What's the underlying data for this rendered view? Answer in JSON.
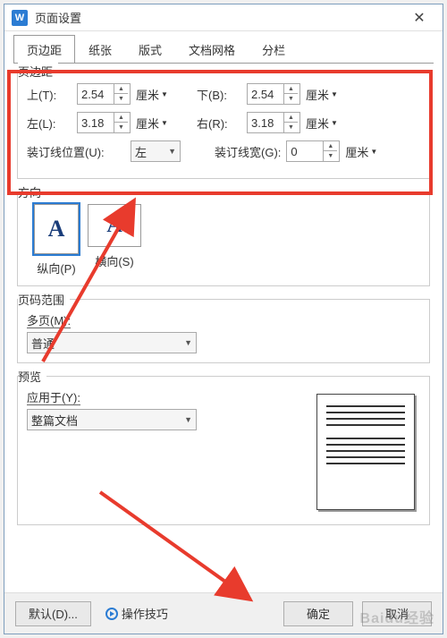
{
  "title": "页面设置",
  "tabs": [
    "页边距",
    "纸张",
    "版式",
    "文档网格",
    "分栏"
  ],
  "margins": {
    "legend": "页边距",
    "top": {
      "label": "上(T):",
      "value": "2.54",
      "unit": "厘米"
    },
    "bottom": {
      "label": "下(B):",
      "value": "2.54",
      "unit": "厘米"
    },
    "left": {
      "label": "左(L):",
      "value": "3.18",
      "unit": "厘米"
    },
    "right": {
      "label": "右(R):",
      "value": "3.18",
      "unit": "厘米"
    },
    "gutter_pos": {
      "label": "装订线位置(U):",
      "value": "左"
    },
    "gutter_w": {
      "label": "装订线宽(G):",
      "value": "0",
      "unit": "厘米"
    }
  },
  "orientation": {
    "legend": "方向",
    "portrait": "纵向(P)",
    "landscape": "横向(S)"
  },
  "page_range": {
    "legend": "页码范围",
    "multi_label": "多页(M):",
    "multi_value": "普通"
  },
  "preview": {
    "legend": "预览",
    "apply_label": "应用于(Y):",
    "apply_value": "整篇文档"
  },
  "footer": {
    "default": "默认(D)...",
    "tips": "操作技巧",
    "ok": "确定",
    "cancel": "取消"
  },
  "watermark": "Baidu经验",
  "dd": "▼",
  "up": "▲",
  "dn": "▼"
}
